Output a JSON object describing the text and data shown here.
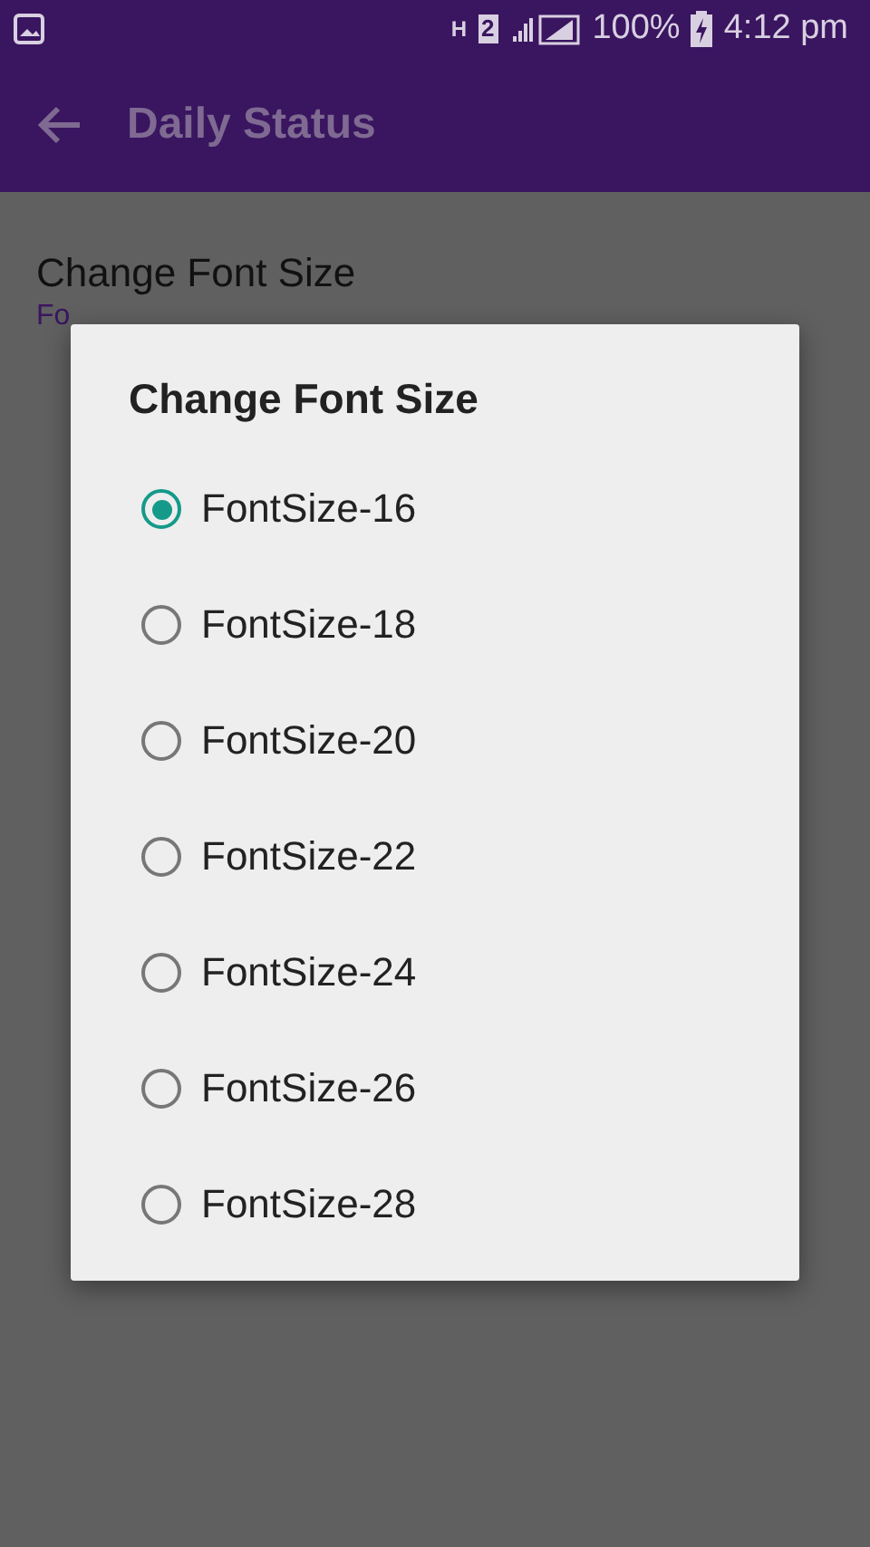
{
  "status_bar": {
    "network_badge": "H",
    "sim_badge": "2",
    "battery": "100%",
    "time": "4:12 pm"
  },
  "app_bar": {
    "title": "Daily Status"
  },
  "preference": {
    "title": "Change Font Size",
    "summary": "Fo"
  },
  "dialog": {
    "title": "Change Font Size",
    "options": [
      {
        "label": "FontSize-16",
        "selected": true
      },
      {
        "label": "FontSize-18",
        "selected": false
      },
      {
        "label": "FontSize-20",
        "selected": false
      },
      {
        "label": "FontSize-22",
        "selected": false
      },
      {
        "label": "FontSize-24",
        "selected": false
      },
      {
        "label": "FontSize-26",
        "selected": false
      },
      {
        "label": "FontSize-28",
        "selected": false
      }
    ]
  }
}
